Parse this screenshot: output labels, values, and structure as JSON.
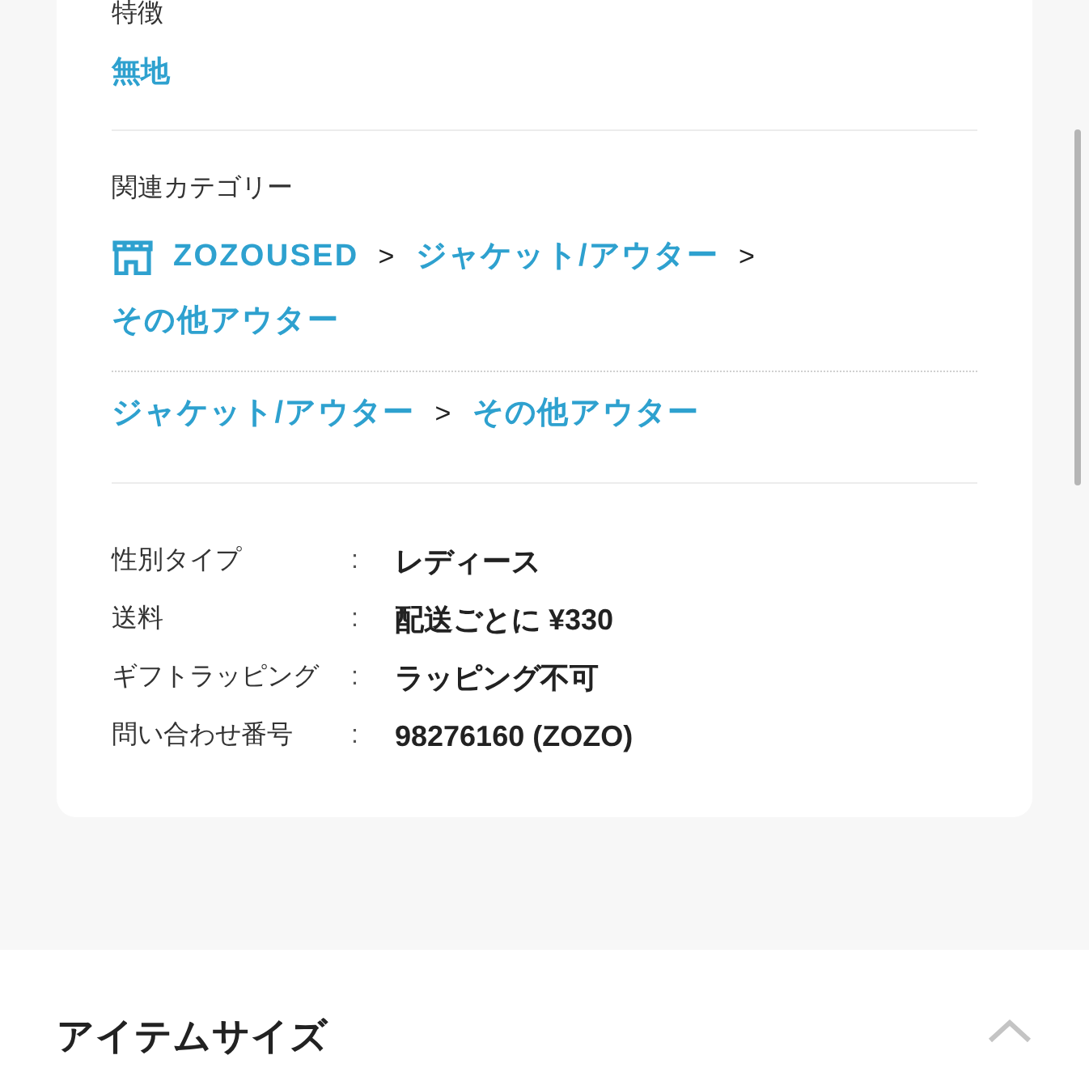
{
  "features": {
    "label": "特徴",
    "value": "無地"
  },
  "related_categories": {
    "label": "関連カテゴリー",
    "paths": [
      {
        "kind": "store",
        "items": [
          "ZOZOUSED",
          "ジャケット/アウター",
          "その他アウター"
        ]
      },
      {
        "kind": "plain",
        "items": [
          "ジャケット/アウター",
          "その他アウター"
        ]
      }
    ],
    "separator": ">"
  },
  "details": {
    "colon": ":",
    "rows": [
      {
        "label": "性別タイプ",
        "value": "レディース"
      },
      {
        "label": "送料",
        "value": "配送ごとに ¥330"
      },
      {
        "label": "ギフトラッピング",
        "value": "ラッピング不可"
      },
      {
        "label": "問い合わせ番号",
        "value": "98276160 (ZOZO)"
      }
    ]
  },
  "size_section": {
    "title": "アイテムサイズ",
    "expanded": true
  }
}
